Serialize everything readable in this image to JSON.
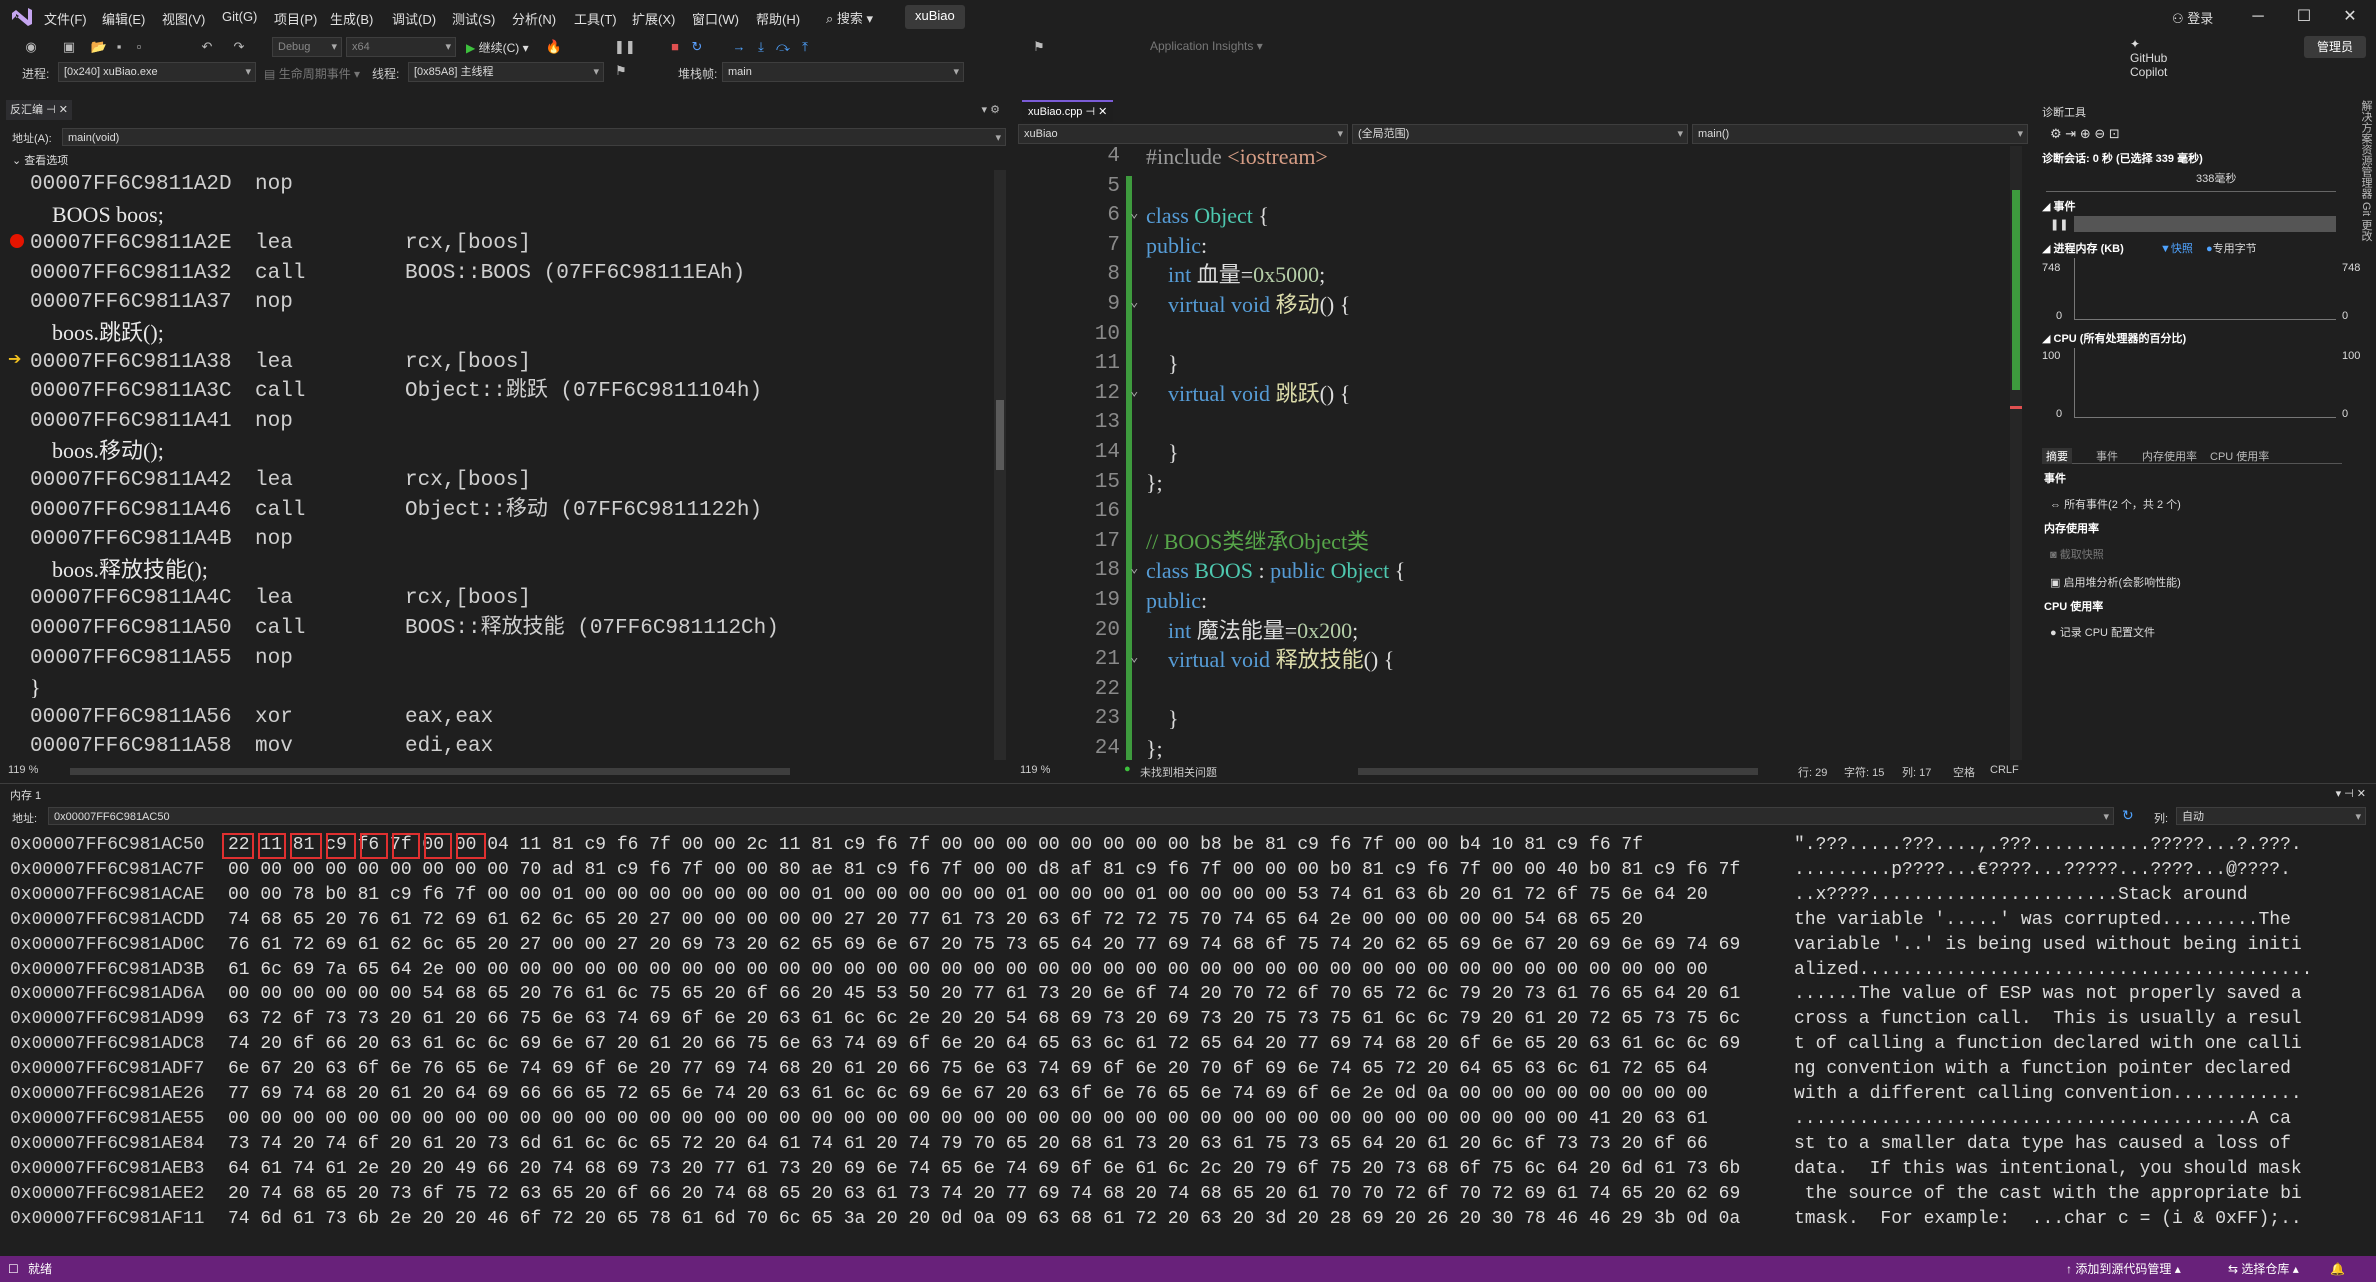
{
  "menu": {
    "items": [
      "文件(F)",
      "编辑(E)",
      "视图(V)",
      "Git(G)",
      "项目(P)",
      "生成(B)",
      "调试(D)",
      "测试(S)",
      "分析(N)",
      "工具(T)",
      "扩展(X)",
      "窗口(W)",
      "帮助(H)"
    ],
    "search": "搜索",
    "project": "xuBiao",
    "login": "登录",
    "copilot": "GitHub Copilot",
    "admin": "管理员"
  },
  "toolbar": {
    "config": "Debug",
    "platform": "x64",
    "continue": "继续(C)",
    "insights": "Application Insights",
    "process_label": "进程:",
    "process": "[0x240] xuBiao.exe",
    "lifecycle": "生命周期事件",
    "thread_label": "线程:",
    "thread": "[0x85A8] 主线程",
    "stack_label": "堆栈帧:",
    "stack": "main"
  },
  "disasm": {
    "tab": "反汇编",
    "address_label": "地址(A):",
    "address": "main(void)",
    "view_options": "查看选项",
    "zoom": "119 %",
    "lines": [
      {
        "kind": "asm",
        "addr": "00007FF6C9811A2D",
        "op": "nop",
        "arg": ""
      },
      {
        "kind": "src",
        "text": "    BOOS boos;"
      },
      {
        "kind": "asm",
        "addr": "00007FF6C9811A2E",
        "op": "lea",
        "arg": "rcx,[boos]"
      },
      {
        "kind": "asm",
        "addr": "00007FF6C9811A32",
        "op": "call",
        "arg": "BOOS::BOOS (07FF6C98111EAh)"
      },
      {
        "kind": "asm",
        "addr": "00007FF6C9811A37",
        "op": "nop",
        "arg": ""
      },
      {
        "kind": "src",
        "text": "    boos.跳跃();"
      },
      {
        "kind": "asm",
        "addr": "00007FF6C9811A38",
        "op": "lea",
        "arg": "rcx,[boos]"
      },
      {
        "kind": "asm",
        "addr": "00007FF6C9811A3C",
        "op": "call",
        "arg": "Object::跳跃 (07FF6C9811104h)"
      },
      {
        "kind": "asm",
        "addr": "00007FF6C9811A41",
        "op": "nop",
        "arg": ""
      },
      {
        "kind": "src",
        "text": "    boos.移动();"
      },
      {
        "kind": "asm",
        "addr": "00007FF6C9811A42",
        "op": "lea",
        "arg": "rcx,[boos]"
      },
      {
        "kind": "asm",
        "addr": "00007FF6C9811A46",
        "op": "call",
        "arg": "Object::移动 (07FF6C9811122h)"
      },
      {
        "kind": "asm",
        "addr": "00007FF6C9811A4B",
        "op": "nop",
        "arg": ""
      },
      {
        "kind": "src",
        "text": "    boos.释放技能();"
      },
      {
        "kind": "asm",
        "addr": "00007FF6C9811A4C",
        "op": "lea",
        "arg": "rcx,[boos]"
      },
      {
        "kind": "asm",
        "addr": "00007FF6C9811A50",
        "op": "call",
        "arg": "BOOS::释放技能 (07FF6C981112Ch)"
      },
      {
        "kind": "asm",
        "addr": "00007FF6C9811A55",
        "op": "nop",
        "arg": ""
      },
      {
        "kind": "src",
        "text": "}"
      },
      {
        "kind": "asm",
        "addr": "00007FF6C9811A56",
        "op": "xor",
        "arg": "eax,eax"
      },
      {
        "kind": "asm",
        "addr": "00007FF6C9811A58",
        "op": "mov",
        "arg": "edi,eax"
      }
    ]
  },
  "editor": {
    "tab": "xuBiao.cpp",
    "project_combo": "xuBiao",
    "scope_combo": "(全局范围)",
    "func_combo": "main()",
    "zoom": "119 %",
    "issues": "未找到相关问题",
    "line": "行: 29",
    "char": "字符: 15",
    "col": "列: 17",
    "spacing": "空格",
    "eol": "CRLF",
    "lines": [
      {
        "n": "4",
        "html": "<span class='pp'>#include</span> <span class='str'>&lt;iostream&gt;</span>"
      },
      {
        "n": "5",
        "html": ""
      },
      {
        "n": "6",
        "html": "<span class='kw'>class</span> <span class='ty'>Object</span> {"
      },
      {
        "n": "7",
        "html": "<span class='kw'>public</span>:"
      },
      {
        "n": "8",
        "html": "    <span class='kw'>int</span> 血量=<span class='num'>0x5000</span>;"
      },
      {
        "n": "9",
        "html": "    <span class='kw'>virtual</span> <span class='kw'>void</span> <span class='fn'>移动</span>() {"
      },
      {
        "n": "10",
        "html": ""
      },
      {
        "n": "11",
        "html": "    }"
      },
      {
        "n": "12",
        "html": "    <span class='kw'>virtual</span> <span class='kw'>void</span> <span class='fn'>跳跃</span>() {"
      },
      {
        "n": "13",
        "html": ""
      },
      {
        "n": "14",
        "html": "    }"
      },
      {
        "n": "15",
        "html": "};"
      },
      {
        "n": "16",
        "html": ""
      },
      {
        "n": "17",
        "html": "<span class='cm'>// BOOS类继承Object类</span>"
      },
      {
        "n": "18",
        "html": "<span class='kw'>class</span> <span class='ty'>BOOS</span> : <span class='kw'>public</span> <span class='ty'>Object</span> {"
      },
      {
        "n": "19",
        "html": "<span class='kw'>public</span>:"
      },
      {
        "n": "20",
        "html": "    <span class='kw'>int</span> 魔法能量=<span class='num'>0x200</span>;"
      },
      {
        "n": "21",
        "html": "    <span class='kw'>virtual</span> <span class='kw'>void</span> <span class='fn'>释放技能</span>() {"
      },
      {
        "n": "22",
        "html": ""
      },
      {
        "n": "23",
        "html": "    }"
      },
      {
        "n": "24",
        "html": "};"
      }
    ]
  },
  "diag": {
    "title": "诊断工具",
    "session": "诊断会话: 0 秒 (已选择 339 毫秒)",
    "ms": "338毫秒",
    "events_section": "事件",
    "memory_section": "进程内存 (KB)",
    "snapshot": "快照",
    "private_bytes": "专用字节",
    "mem_top_left": "748",
    "mem_bottom_left": "0",
    "mem_top_right": "748",
    "mem_bottom_right": "0",
    "cpu_section": "CPU (所有处理器的百分比)",
    "cpu_top_left": "100",
    "cpu_bottom_left": "0",
    "cpu_top_right": "100",
    "cpu_bottom_right": "0",
    "tabs": [
      "摘要",
      "事件",
      "内存使用率",
      "CPU 使用率"
    ],
    "sum_events": "事件",
    "all_events": "所有事件(2 个，共 2 个)",
    "mem_usage": "内存使用率",
    "take_snapshot": "截取快照",
    "heap_analysis": "启用堆分析(会影响性能)",
    "cpu_usage": "CPU 使用率",
    "record_cpu": "记录 CPU 配置文件",
    "side_tabs": "解决方案资源管理器 Git 更改"
  },
  "memory": {
    "tab": "内存 1",
    "address_label": "地址:",
    "address": "0x00007FF6C981AC50",
    "columns_label": "列:",
    "columns": "自动",
    "rows": [
      {
        "a": "0x00007FF6C981AC50",
        "h": "22 11 81 c9 f6 7f 00 00 04 11 81 c9 f6 7f 00 00 2c 11 81 c9 f6 7f 00 00 00 00 00 00 00 00 b8 be 81 c9 f6 7f 00 00 b4 10 81 c9 f6 7f",
        "t": "\".???.....???....,.???...........?????...?.???."
      },
      {
        "a": "0x00007FF6C981AC7F",
        "h": "00 00 00 00 00 00 00 00 00 70 ad 81 c9 f6 7f 00 00 80 ae 81 c9 f6 7f 00 00 d8 af 81 c9 f6 7f 00 00 00 b0 81 c9 f6 7f 00 00 40 b0 81 c9 f6 7f",
        "t": ".........p????...€????...?????...????...@????."
      },
      {
        "a": "0x00007FF6C981ACAE",
        "h": "00 00 78 b0 81 c9 f6 7f 00 00 01 00 00 00 00 00 00 00 01 00 00 00 00 00 01 00 00 00 01 00 00 00 00 53 74 61 63 6b 20 61 72 6f 75 6e 64 20",
        "t": "..x????.......................Stack around "
      },
      {
        "a": "0x00007FF6C981ACDD",
        "h": "74 68 65 20 76 61 72 69 61 62 6c 65 20 27 00 00 00 00 00 27 20 77 61 73 20 63 6f 72 72 75 70 74 65 64 2e 00 00 00 00 00 54 68 65 20",
        "t": "the variable '.....' was corrupted.........The "
      },
      {
        "a": "0x00007FF6C981AD0C",
        "h": "76 61 72 69 61 62 6c 65 20 27 00 00 27 20 69 73 20 62 65 69 6e 67 20 75 73 65 64 20 77 69 74 68 6f 75 74 20 62 65 69 6e 67 20 69 6e 69 74 69",
        "t": "variable '..' is being used without being initi"
      },
      {
        "a": "0x00007FF6C981AD3B",
        "h": "61 6c 69 7a 65 64 2e 00 00 00 00 00 00 00 00 00 00 00 00 00 00 00 00 00 00 00 00 00 00 00 00 00 00 00 00 00 00 00 00 00 00 00 00 00 00 00",
        "t": "alized.........................................."
      },
      {
        "a": "0x00007FF6C981AD6A",
        "h": "00 00 00 00 00 00 54 68 65 20 76 61 6c 75 65 20 6f 66 20 45 53 50 20 77 61 73 20 6e 6f 74 20 70 72 6f 70 65 72 6c 79 20 73 61 76 65 64 20 61",
        "t": "......The value of ESP was not properly saved a"
      },
      {
        "a": "0x00007FF6C981AD99",
        "h": "63 72 6f 73 73 20 61 20 66 75 6e 63 74 69 6f 6e 20 63 61 6c 6c 2e 20 20 54 68 69 73 20 69 73 20 75 73 75 61 6c 6c 79 20 61 20 72 65 73 75 6c",
        "t": "cross a function call.  This is usually a resul"
      },
      {
        "a": "0x00007FF6C981ADC8",
        "h": "74 20 6f 66 20 63 61 6c 6c 69 6e 67 20 61 20 66 75 6e 63 74 69 6f 6e 20 64 65 63 6c 61 72 65 64 20 77 69 74 68 20 6f 6e 65 20 63 61 6c 6c 69",
        "t": "t of calling a function declared with one calli"
      },
      {
        "a": "0x00007FF6C981ADF7",
        "h": "6e 67 20 63 6f 6e 76 65 6e 74 69 6f 6e 20 77 69 74 68 20 61 20 66 75 6e 63 74 69 6f 6e 20 70 6f 69 6e 74 65 72 20 64 65 63 6c 61 72 65 64",
        "t": "ng convention with a function pointer declared"
      },
      {
        "a": "0x00007FF6C981AE26",
        "h": "77 69 74 68 20 61 20 64 69 66 66 65 72 65 6e 74 20 63 61 6c 6c 69 6e 67 20 63 6f 6e 76 65 6e 74 69 6f 6e 2e 0d 0a 00 00 00 00 00 00 00 00",
        "t": "with a different calling convention............"
      },
      {
        "a": "0x00007FF6C981AE55",
        "h": "00 00 00 00 00 00 00 00 00 00 00 00 00 00 00 00 00 00 00 00 00 00 00 00 00 00 00 00 00 00 00 00 00 00 00 00 00 00 00 00 00 00 41 20 63 61",
        "t": "..........................................A ca"
      },
      {
        "a": "0x00007FF6C981AE84",
        "h": "73 74 20 74 6f 20 61 20 73 6d 61 6c 6c 65 72 20 64 61 74 61 20 74 79 70 65 20 68 61 73 20 63 61 75 73 65 64 20 61 20 6c 6f 73 73 20 6f 66",
        "t": "st to a smaller data type has caused a loss of"
      },
      {
        "a": "0x00007FF6C981AEB3",
        "h": "64 61 74 61 2e 20 20 49 66 20 74 68 69 73 20 77 61 73 20 69 6e 74 65 6e 74 69 6f 6e 61 6c 2c 20 79 6f 75 20 73 68 6f 75 6c 64 20 6d 61 73 6b",
        "t": "data.  If this was intentional, you should mask"
      },
      {
        "a": "0x00007FF6C981AEE2",
        "h": "20 74 68 65 20 73 6f 75 72 63 65 20 6f 66 20 74 68 65 20 63 61 73 74 20 77 69 74 68 20 74 68 65 20 61 70 70 72 6f 70 72 69 61 74 65 20 62 69",
        "t": " the source of the cast with the appropriate bi"
      },
      {
        "a": "0x00007FF6C981AF11",
        "h": "74 6d 61 73 6b 2e 20 20 46 6f 72 20 65 78 61 6d 70 6c 65 3a 20 20 0d 0a 09 63 68 61 72 20 63 20 3d 20 28 69 20 26 20 30 78 46 46 29 3b 0d 0a",
        "t": "tmask.  For example:  ...char c = (i & 0xFF);.."
      }
    ]
  },
  "status": {
    "ready": "就绪",
    "add_source": "添加到源代码管理",
    "select_repo": "选择仓库"
  }
}
